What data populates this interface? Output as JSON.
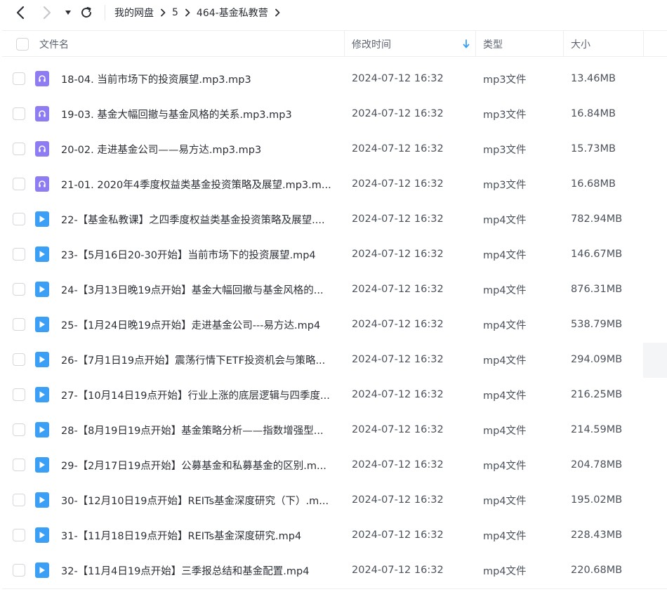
{
  "nav": {
    "back_icon": "chevron-left-icon",
    "forward_icon": "chevron-right-icon",
    "history_icon": "caret-down-icon",
    "refresh_icon": "refresh-icon"
  },
  "breadcrumb": {
    "items": [
      "我的网盘",
      "5",
      "464-基金私教营"
    ]
  },
  "table": {
    "headers": {
      "name": "文件名",
      "modified": "修改时间",
      "type": "类型",
      "size": "大小"
    },
    "sort_icon": "arrow-down-icon",
    "rows": [
      {
        "name": "18-04. 当前市场下的投资展望.mp3.mp3",
        "modified": "2024-07-12 16:32",
        "type": "mp3文件",
        "size": "13.46MB",
        "icon": "audio-file-icon"
      },
      {
        "name": "19-03. 基金大幅回撤与基金风格的关系.mp3.mp3",
        "modified": "2024-07-12 16:32",
        "type": "mp3文件",
        "size": "16.84MB",
        "icon": "audio-file-icon"
      },
      {
        "name": "20-02. 走进基金公司——易方达.mp3.mp3",
        "modified": "2024-07-12 16:32",
        "type": "mp3文件",
        "size": "15.73MB",
        "icon": "audio-file-icon"
      },
      {
        "name": "21-01. 2020年4季度权益类基金投资策略及展望.mp3.m...",
        "modified": "2024-07-12 16:32",
        "type": "mp3文件",
        "size": "16.68MB",
        "icon": "audio-file-icon"
      },
      {
        "name": "22-【基金私教课】之四季度权益类基金投资策略及展望....",
        "modified": "2024-07-12 16:32",
        "type": "mp4文件",
        "size": "782.94MB",
        "icon": "video-file-icon"
      },
      {
        "name": "23-【5月16日20-30开始】当前市场下的投资展望.mp4",
        "modified": "2024-07-12 16:32",
        "type": "mp4文件",
        "size": "146.67MB",
        "icon": "video-file-icon"
      },
      {
        "name": "24-【3月13日晚19点开始】基金大幅回撤与基金风格的...",
        "modified": "2024-07-12 16:32",
        "type": "mp4文件",
        "size": "876.31MB",
        "icon": "video-file-icon"
      },
      {
        "name": "25-【1月24日晚19点开始】走进基金公司---易方达.mp4",
        "modified": "2024-07-12 16:32",
        "type": "mp4文件",
        "size": "538.79MB",
        "icon": "video-file-icon"
      },
      {
        "name": "26-【7月1日19点开始】震荡行情下ETF投资机会与策略...",
        "modified": "2024-07-12 16:32",
        "type": "mp4文件",
        "size": "294.09MB",
        "icon": "video-file-icon"
      },
      {
        "name": "27-【10月14日19点开始】行业上涨的底层逻辑与四季度...",
        "modified": "2024-07-12 16:32",
        "type": "mp4文件",
        "size": "216.25MB",
        "icon": "video-file-icon"
      },
      {
        "name": "28-【8月19日19点开始】基金策略分析——指数增强型...",
        "modified": "2024-07-12 16:32",
        "type": "mp4文件",
        "size": "214.59MB",
        "icon": "video-file-icon"
      },
      {
        "name": "29-【2月17日19点开始】公募基金和私募基金的区别.m...",
        "modified": "2024-07-12 16:32",
        "type": "mp4文件",
        "size": "204.78MB",
        "icon": "video-file-icon"
      },
      {
        "name": "30-【12月10日19点开始】REITs基金深度研究（下）.m...",
        "modified": "2024-07-12 16:32",
        "type": "mp4文件",
        "size": "195.02MB",
        "icon": "video-file-icon"
      },
      {
        "name": "31-【11月18日19点开始】REITs基金深度研究.mp4",
        "modified": "2024-07-12 16:32",
        "type": "mp4文件",
        "size": "228.43MB",
        "icon": "video-file-icon"
      },
      {
        "name": "32-【11月4日19点开始】三季报总结和基金配置.mp4",
        "modified": "2024-07-12 16:32",
        "type": "mp4文件",
        "size": "220.68MB",
        "icon": "video-file-icon"
      }
    ]
  },
  "colors": {
    "audio_icon": "#8e7cf3",
    "video_icon": "#3a9ff5",
    "sort_arrow": "#3a9ff5"
  }
}
